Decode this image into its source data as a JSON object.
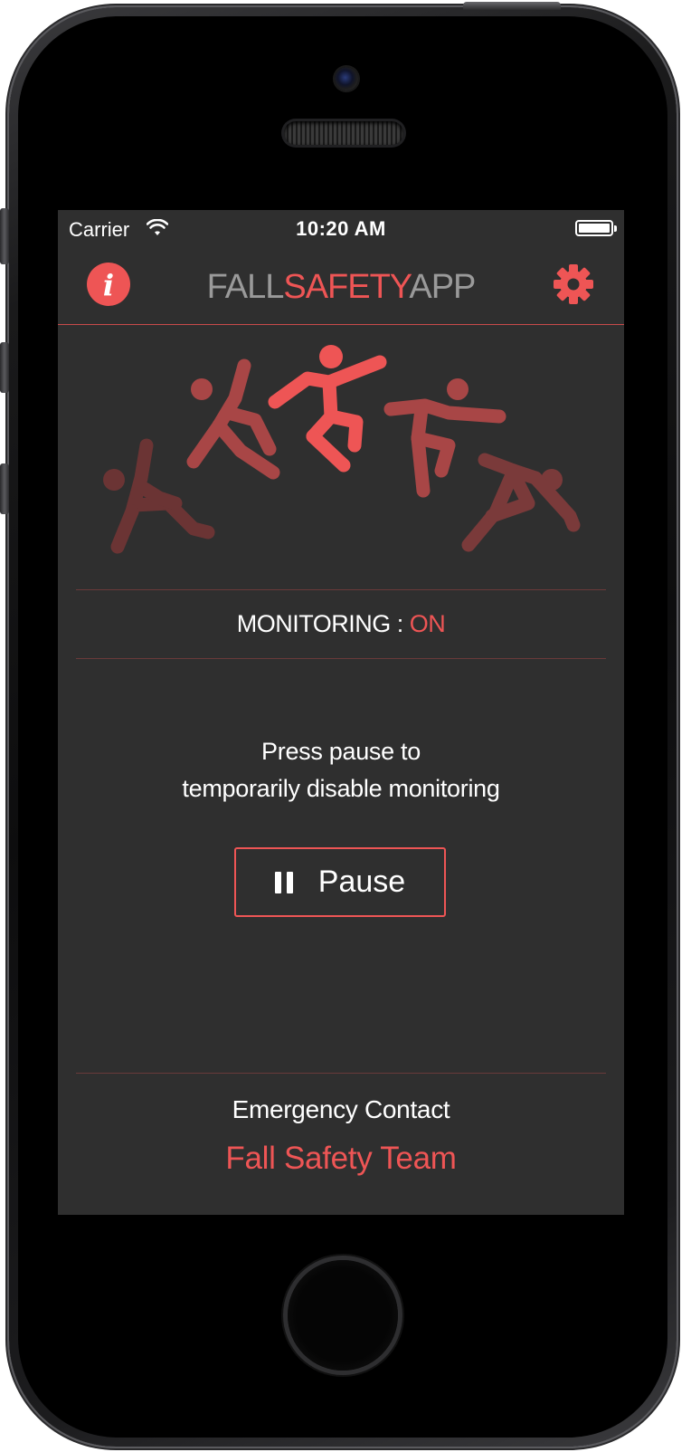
{
  "status_bar": {
    "carrier": "Carrier",
    "time": "10:20 AM"
  },
  "header": {
    "title_parts": [
      "FALL",
      "SAFETY",
      "APP"
    ],
    "info_icon": "info-icon",
    "settings_icon": "gear-icon"
  },
  "illustration": {
    "icon": "falling-person-sequence",
    "colors": [
      "#6b3434",
      "#a84646",
      "#ee5555",
      "#a84646",
      "#7a3a3a"
    ]
  },
  "monitoring": {
    "label": "MONITORING : ",
    "state": "ON"
  },
  "hint": {
    "line1": "Press pause to",
    "line2": "temporarily disable monitoring"
  },
  "pause_button": {
    "icon": "pause-icon",
    "label": "Pause"
  },
  "emergency": {
    "label": "Emergency Contact",
    "name": "Fall Safety Team"
  },
  "colors": {
    "accent": "#ee5555",
    "background": "#2f2f2f",
    "text": "#ffffff"
  }
}
